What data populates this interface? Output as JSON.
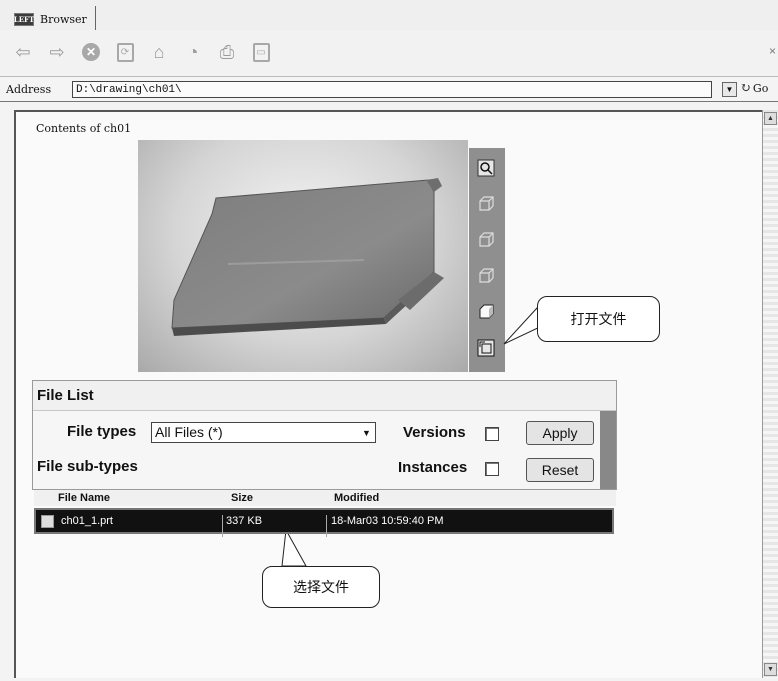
{
  "tab": {
    "icon_text": "LEFT",
    "title": "Browser"
  },
  "toolbar": {
    "back_icon": "arrow-left-icon",
    "forward_icon": "arrow-right-icon",
    "stop_icon": "stop-icon",
    "far_right": "×"
  },
  "address": {
    "label": "Address",
    "value": "D:\\drawing\\ch01\\",
    "go_label": "Go"
  },
  "content": {
    "title": "Contents of ch01",
    "callout_open": "打开文件",
    "callout_select": "选择文件"
  },
  "file_list": {
    "header": "File List",
    "file_types_label": "File types",
    "file_types_value": "All Files (*)",
    "file_subtypes_label": "File sub-types",
    "versions_label": "Versions",
    "instances_label": "Instances",
    "apply_label": "Apply",
    "reset_label": "Reset"
  },
  "results": {
    "columns": [
      "File Name",
      "Size",
      "Modified"
    ],
    "rows": [
      {
        "name": "ch01_1.prt",
        "size": "337 KB",
        "modified": "18-Mar03 10:59:40 PM"
      }
    ]
  },
  "colors": {
    "accent_dark_row": "#111111",
    "panel_strip": "#888888"
  }
}
